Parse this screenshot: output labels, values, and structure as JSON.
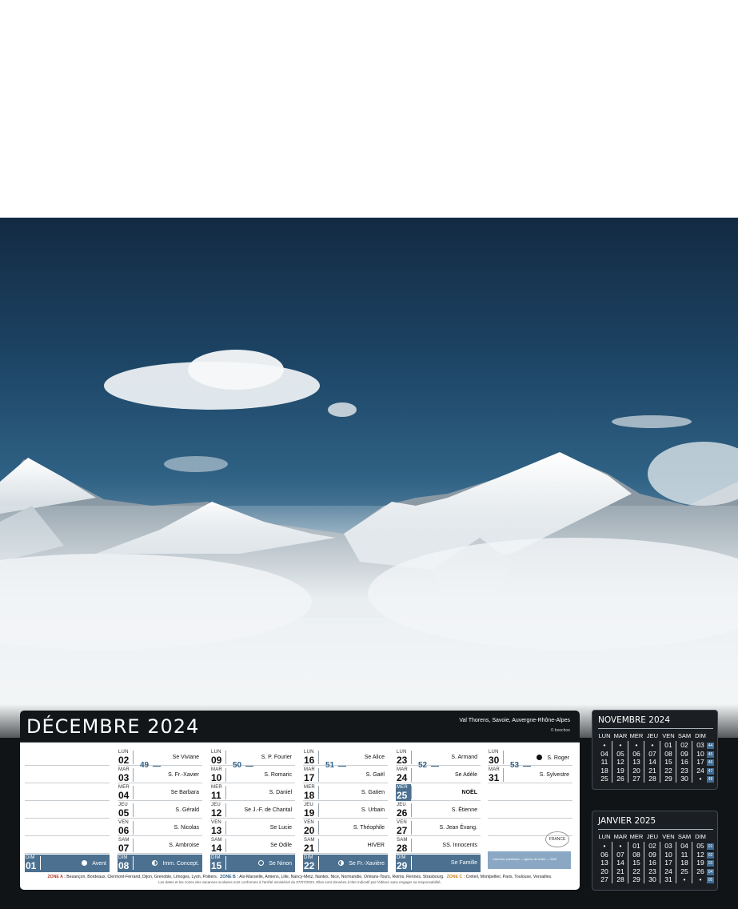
{
  "page": {
    "month_title": "DÉCEMBRE 2024",
    "location": "Val Thorens, Savoie, Auvergne-Rhône-Alpes",
    "photo_credit": "© bonchoe",
    "accent_color": "#4b7090"
  },
  "weeks": [
    {
      "number": "49"
    },
    {
      "number": "50"
    },
    {
      "number": "51"
    },
    {
      "number": "52"
    },
    {
      "number": "53"
    }
  ],
  "columns": [
    {
      "days": [
        {
          "name": "DIM",
          "num": "01",
          "saint": "Avent",
          "moon": "full"
        }
      ]
    },
    {
      "days": [
        {
          "name": "LUN",
          "num": "02",
          "saint": "Se Viviane"
        },
        {
          "name": "MAR",
          "num": "03",
          "saint": "S. Fr.-Xavier"
        },
        {
          "name": "MER",
          "num": "04",
          "saint": "Se Barbara"
        },
        {
          "name": "JEU",
          "num": "05",
          "saint": "S. Gérald"
        },
        {
          "name": "VEN",
          "num": "06",
          "saint": "S. Nicolas"
        },
        {
          "name": "SAM",
          "num": "07",
          "saint": "S. Ambroise"
        },
        {
          "name": "DIM",
          "num": "08",
          "saint": "Imm. Concept.",
          "moon": "half"
        }
      ]
    },
    {
      "days": [
        {
          "name": "LUN",
          "num": "09",
          "saint": "S. P. Fourier"
        },
        {
          "name": "MAR",
          "num": "10",
          "saint": "S. Romaric"
        },
        {
          "name": "MER",
          "num": "11",
          "saint": "S. Daniel"
        },
        {
          "name": "JEU",
          "num": "12",
          "saint": "Se J.-F. de Chantal"
        },
        {
          "name": "VEN",
          "num": "13",
          "saint": "Se Lucie"
        },
        {
          "name": "SAM",
          "num": "14",
          "saint": "Se Odile"
        },
        {
          "name": "DIM",
          "num": "15",
          "saint": "Se Ninon",
          "moon": "ring"
        }
      ]
    },
    {
      "days": [
        {
          "name": "LUN",
          "num": "16",
          "saint": "Se Alice"
        },
        {
          "name": "MAR",
          "num": "17",
          "saint": "S. Gaël"
        },
        {
          "name": "MER",
          "num": "18",
          "saint": "S. Gatien"
        },
        {
          "name": "JEU",
          "num": "19",
          "saint": "S. Urbain"
        },
        {
          "name": "VEN",
          "num": "20",
          "saint": "S. Théophile"
        },
        {
          "name": "SAM",
          "num": "21",
          "saint": "HIVER"
        },
        {
          "name": "DIM",
          "num": "22",
          "saint": "Se Fr.-Xavière",
          "moon": "halfr"
        }
      ]
    },
    {
      "days": [
        {
          "name": "LUN",
          "num": "23",
          "saint": "S. Armand"
        },
        {
          "name": "MAR",
          "num": "24",
          "saint": "Se Adèle"
        },
        {
          "name": "MER",
          "num": "25",
          "saint": "NOËL",
          "holiday": true
        },
        {
          "name": "JEU",
          "num": "26",
          "saint": "S. Étienne"
        },
        {
          "name": "VEN",
          "num": "27",
          "saint": "S. Jean Évang."
        },
        {
          "name": "SAM",
          "num": "28",
          "saint": "SS. Innocents"
        },
        {
          "name": "DIM",
          "num": "29",
          "saint": "Se Famille"
        }
      ]
    },
    {
      "days": [
        {
          "name": "LUN",
          "num": "30",
          "saint": "S. Roger",
          "moon": "new"
        },
        {
          "name": "MAR",
          "num": "31",
          "saint": "S. Sylvestre"
        }
      ]
    }
  ],
  "stamp": "FRANCE",
  "ad_text": "Calendrier publicitaire — Agence de la Mer — 2025",
  "legend": {
    "zone_a_label": "ZONE A :",
    "zone_a": "Besançon, Bordeaux, Clermont-Ferrand, Dijon, Grenoble, Limoges, Lyon, Poitiers.",
    "zone_b_label": "ZONE B :",
    "zone_b": "Aix-Marseille, Amiens, Lille, Nancy-Metz, Nantes, Nice, Normandie, Orléans-Tours, Reims, Rennes, Strasbourg.",
    "zone_c_label": "ZONE C :",
    "zone_c": "Créteil, Montpellier, Paris, Toulouse, Versailles.",
    "note": "Les dates et les zones des vacances scolaires sont conformes à l'arrêté ministériel du 07/07/2023. Elles sont données à titre indicatif par l'éditeur sans engager sa responsabilité."
  },
  "mini_headers": [
    "LUN",
    "MAR",
    "MER",
    "JEU",
    "VEN",
    "SAM",
    "DIM"
  ],
  "mini_calendars": [
    {
      "title": "NOVEMBRE 2024",
      "rows": [
        [
          "•",
          "•",
          "•",
          "•",
          "01",
          "02",
          "03"
        ],
        [
          "04",
          "05",
          "06",
          "07",
          "08",
          "09",
          "10"
        ],
        [
          "11",
          "12",
          "13",
          "14",
          "15",
          "16",
          "17"
        ],
        [
          "18",
          "19",
          "20",
          "21",
          "22",
          "23",
          "24"
        ],
        [
          "25",
          "26",
          "27",
          "28",
          "29",
          "30",
          "•"
        ]
      ],
      "weeks": [
        "44",
        "45",
        "46",
        "47",
        "48"
      ]
    },
    {
      "title": "JANVIER 2025",
      "rows": [
        [
          "•",
          "•",
          "01",
          "02",
          "03",
          "04",
          "05"
        ],
        [
          "06",
          "07",
          "08",
          "09",
          "10",
          "11",
          "12"
        ],
        [
          "13",
          "14",
          "15",
          "16",
          "17",
          "18",
          "19"
        ],
        [
          "20",
          "21",
          "22",
          "23",
          "24",
          "25",
          "26"
        ],
        [
          "27",
          "28",
          "29",
          "30",
          "31",
          "•",
          "•"
        ]
      ],
      "weeks": [
        "01",
        "02",
        "03",
        "04",
        "05"
      ]
    }
  ]
}
